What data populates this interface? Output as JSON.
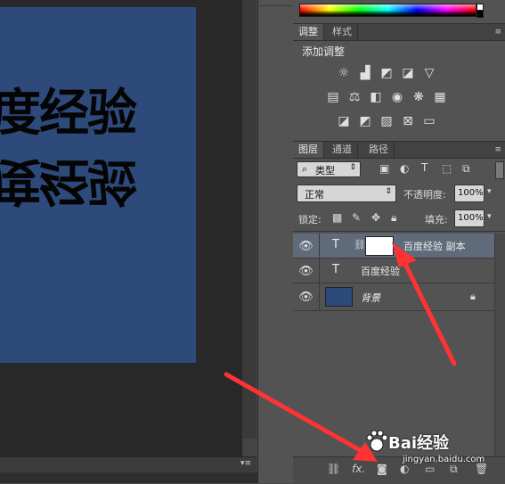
{
  "canvas": {
    "art_top_text": "度经验",
    "art_bottom_text": "度经验",
    "doc_color": "#2d4a7b"
  },
  "status": {
    "menu_glyph": "▾≡"
  },
  "adjustments": {
    "tabs": [
      "调整",
      "样式"
    ],
    "title": "添加调整",
    "icons": [
      "brightness-icon",
      "levels-icon",
      "curves-icon",
      "exposure-icon",
      "vibrance-icon",
      "hue-saturation-icon",
      "color-balance-icon",
      "black-white-icon",
      "photo-filter-icon",
      "channel-mixer-icon",
      "color-lookup-icon",
      "invert-icon",
      "posterize-icon",
      "threshold-icon",
      "selective-color-icon",
      "gradient-map-icon"
    ]
  },
  "layers": {
    "tabs": [
      "图层",
      "通道",
      "路径"
    ],
    "filter_kind": "类型",
    "blend_mode": "正常",
    "opacity_label": "不透明度:",
    "opacity_value": "100%",
    "lock_label": "锁定:",
    "fill_label": "填充:",
    "fill_value": "100%",
    "rows": [
      {
        "name": "百度经验 副本",
        "selected": true
      },
      {
        "name": "百度经验",
        "selected": false
      },
      {
        "name": "背景",
        "selected": false
      }
    ]
  },
  "footer": {
    "fx_label": "fx."
  },
  "watermark": {
    "text": "Bai经验",
    "url": "jingyan.baidu.com"
  },
  "colors": {
    "panel_bg": "#535353",
    "canvas_bg": "#282828",
    "selection": "#5f6b7a",
    "arrow": "#ff3333"
  }
}
